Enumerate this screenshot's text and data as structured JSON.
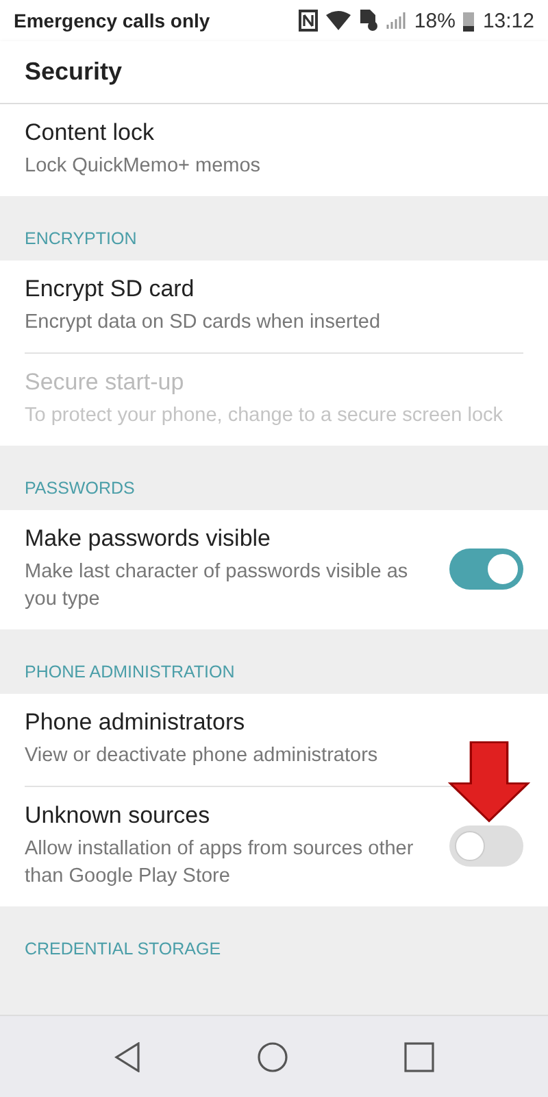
{
  "status_bar": {
    "carrier": "Emergency calls only",
    "battery": "18%",
    "time": "13:12"
  },
  "toolbar": {
    "title": "Security"
  },
  "sections": [
    {
      "items": [
        {
          "kind": "plain",
          "title": "Content lock",
          "subtitle": "Lock QuickMemo+ memos",
          "disabled": false
        }
      ]
    },
    {
      "header": "ENCRYPTION",
      "items": [
        {
          "kind": "plain",
          "title": "Encrypt SD card",
          "subtitle": "Encrypt data on SD cards when inserted",
          "disabled": false
        },
        {
          "kind": "plain",
          "title": "Secure start-up",
          "subtitle": "To protect your phone, change to a secure screen lock",
          "disabled": true
        }
      ]
    },
    {
      "header": "PASSWORDS",
      "items": [
        {
          "kind": "switch",
          "title": "Make passwords visible",
          "subtitle": "Make last character of passwords visible as you type",
          "disabled": false,
          "on": true
        }
      ]
    },
    {
      "header": "PHONE ADMINISTRATION",
      "items": [
        {
          "kind": "plain",
          "title": "Phone administrators",
          "subtitle": "View or deactivate phone administrators",
          "disabled": false
        },
        {
          "kind": "switch",
          "title": "Unknown sources",
          "subtitle": "Allow installation of apps from sources other than Google Play Store",
          "disabled": false,
          "on": false
        }
      ]
    },
    {
      "header": "CREDENTIAL STORAGE"
    }
  ]
}
